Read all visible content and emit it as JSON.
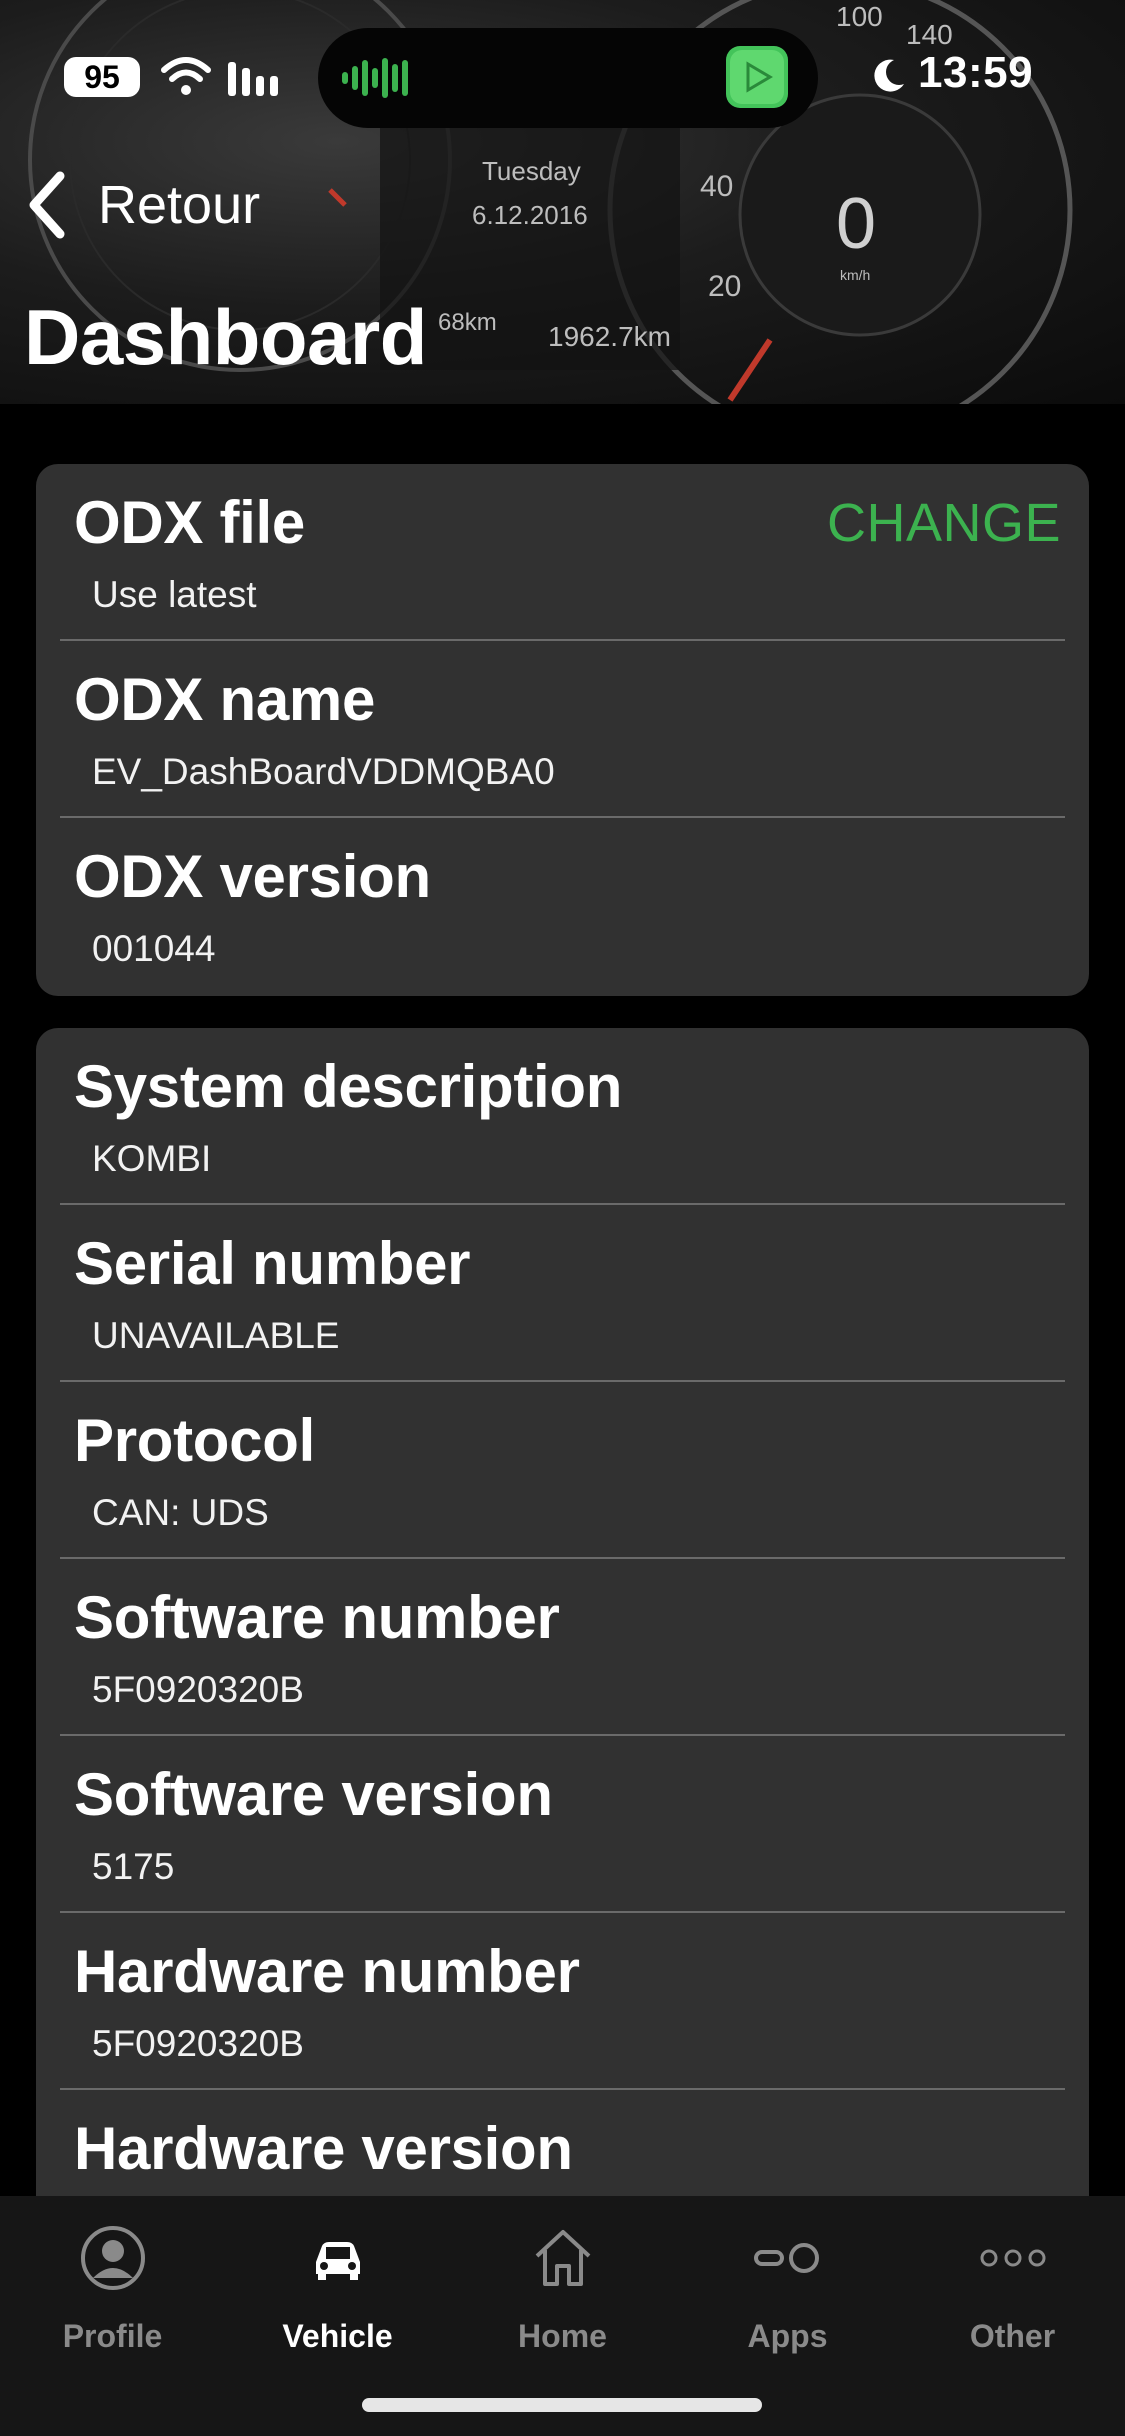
{
  "status_bar": {
    "battery": "95",
    "time": "13:59"
  },
  "nav": {
    "back_label": "Retour",
    "title": "Dashboard"
  },
  "background_text": {
    "day": "Tuesday",
    "date": "6.12.2016",
    "odometer": "1962.7km",
    "range": "68km",
    "speed": "0",
    "speed_unit": "km/h",
    "gauge_40": "40",
    "gauge_20": "20",
    "gauge_100": "100",
    "gauge_140": "140"
  },
  "odx_card": {
    "change_label": "CHANGE",
    "rows": [
      {
        "label": "ODX file",
        "value": "Use latest"
      },
      {
        "label": "ODX name",
        "value": "EV_DashBoardVDDMQBA0"
      },
      {
        "label": "ODX version",
        "value": "001044"
      }
    ]
  },
  "info_card": {
    "rows": [
      {
        "label": "System description",
        "value": "KOMBI"
      },
      {
        "label": "Serial number",
        "value": "UNAVAILABLE"
      },
      {
        "label": "Protocol",
        "value": "CAN: UDS"
      },
      {
        "label": "Software number",
        "value": "5F0920320B"
      },
      {
        "label": "Software version",
        "value": "5175"
      },
      {
        "label": "Hardware number",
        "value": "5F0920320B"
      },
      {
        "label": "Hardware version",
        "value": ""
      }
    ]
  },
  "tab_bar": {
    "tabs": [
      {
        "label": "Profile",
        "icon": "profile-icon"
      },
      {
        "label": "Vehicle",
        "icon": "car-icon",
        "active": true
      },
      {
        "label": "Home",
        "icon": "home-icon"
      },
      {
        "label": "Apps",
        "icon": "apps-icon"
      },
      {
        "label": "Other",
        "icon": "more-icon"
      }
    ]
  },
  "colors": {
    "accent": "#3cb24f",
    "card": "#313131",
    "background": "#000000",
    "tab_inactive": "#8a8a8a"
  }
}
